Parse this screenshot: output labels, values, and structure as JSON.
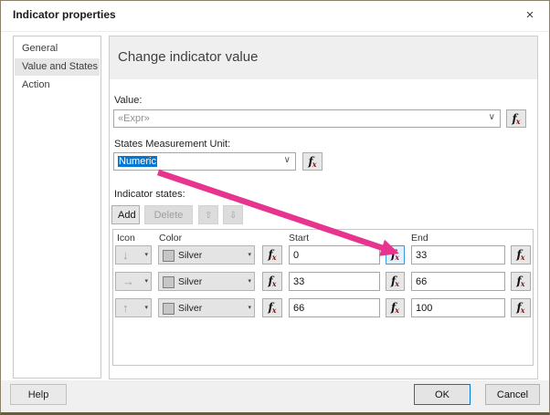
{
  "window": {
    "title": "Indicator properties",
    "close": "×"
  },
  "sidebar": {
    "items": [
      {
        "label": "General"
      },
      {
        "label": "Value and States"
      },
      {
        "label": "Action"
      }
    ],
    "selected": "Value and States"
  },
  "panel": {
    "heading": "Change indicator value",
    "value_label": "Value:",
    "value_text": "«Expr»",
    "smu_label": "States Measurement Unit:",
    "smu_value": "Numeric",
    "states_label": "Indicator states:",
    "toolbar": {
      "add": "Add",
      "delete": "Delete",
      "move_up": "⇧",
      "move_down": "⇩"
    },
    "columns": [
      "Icon",
      "Color",
      "Start",
      "End"
    ],
    "rows": [
      {
        "icon": "↓",
        "color": "Silver",
        "start": "0",
        "end": "33"
      },
      {
        "icon": "→",
        "color": "Silver",
        "start": "33",
        "end": "66"
      },
      {
        "icon": "↑",
        "color": "Silver",
        "start": "66",
        "end": "100"
      }
    ]
  },
  "footer": {
    "help": "Help",
    "ok": "OK",
    "cancel": "Cancel"
  },
  "fx": {
    "f": "f",
    "x": "x"
  },
  "icons": {
    "caret": "▾",
    "chevron": "∨"
  },
  "colors": {
    "accent": "#0078d7",
    "arrow": "#e6348f",
    "silver": "#c6c6c6",
    "fx_highlight_border": "#3d9ae0",
    "fx_highlight_bg": "#e1f0fb"
  }
}
